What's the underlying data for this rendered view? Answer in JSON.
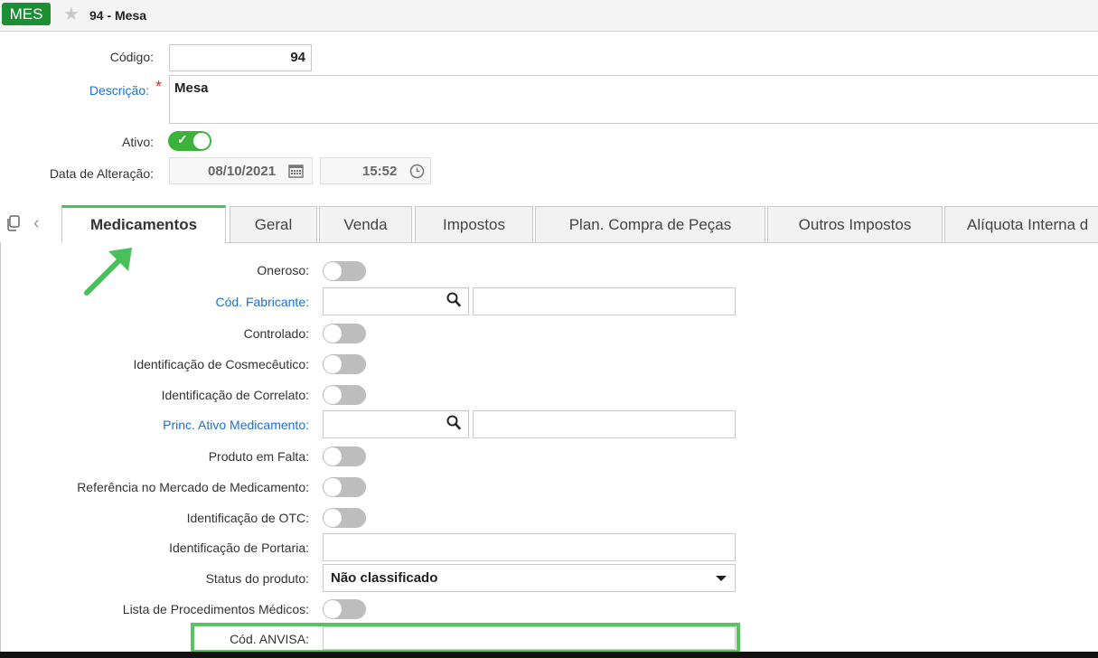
{
  "header": {
    "badge": "MES",
    "title": "94 - Mesa",
    "star_icon": "star-icon"
  },
  "form": {
    "codigo_label": "Código:",
    "codigo_value": "94",
    "descricao_label": "Descrição:",
    "descricao_required": "*",
    "descricao_value": "Mesa",
    "ativo_label": "Ativo:",
    "ativo_value": true,
    "data_alteracao_label": "Data de Alteração:",
    "data_value": "08/10/2021",
    "hora_value": "15:52"
  },
  "tabs": [
    "Medicamentos",
    "Geral",
    "Venda",
    "Impostos",
    "Plan. Compra de Peças",
    "Outros Impostos",
    "Alíquota Interna d"
  ],
  "active_tab": "Medicamentos",
  "fields": {
    "oneroso": "Oneroso:",
    "cod_fabricante": "Cód. Fabricante:",
    "controlado": "Controlado:",
    "cosmeceutico": "Identificação de Cosmecêutico:",
    "correlato": "Identificação de Correlato:",
    "princ_ativo": "Princ. Ativo Medicamento:",
    "produto_falta": "Produto em Falta:",
    "referencia": "Referência no Mercado de Medicamento:",
    "otc": "Identificação de OTC:",
    "portaria": "Identificação de Portaria:",
    "status_label": "Status do produto:",
    "status_value": "Não classificado",
    "lista_proc": "Lista de Procedimentos Médicos:",
    "anvisa": "Cód. ANVISA:"
  },
  "colors": {
    "accent": "#49c15a",
    "badge": "#1a8f34",
    "link": "#1f6fd1"
  }
}
